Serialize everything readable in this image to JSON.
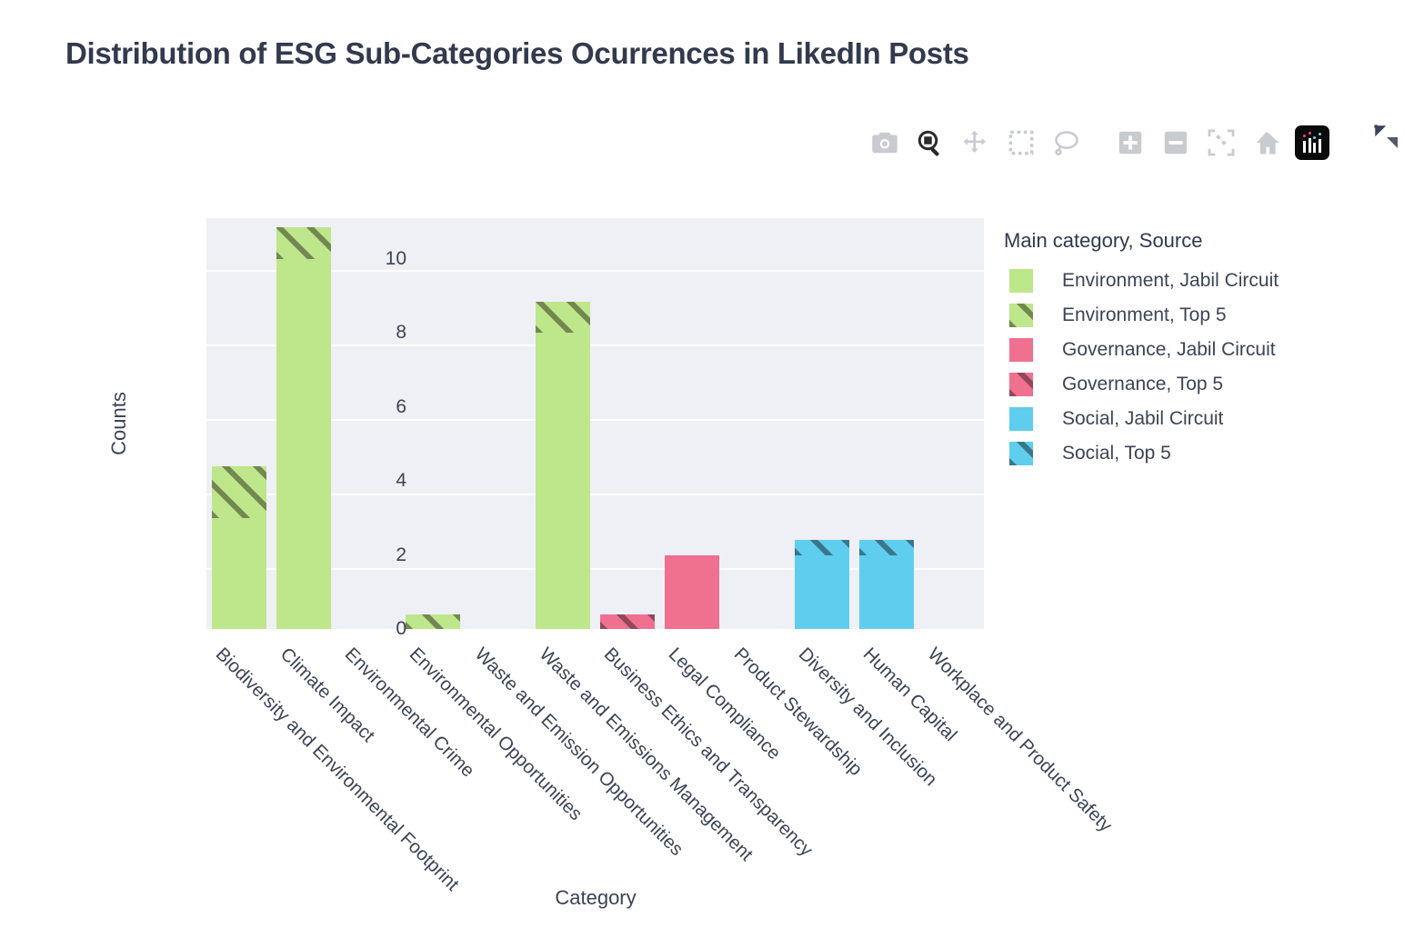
{
  "title": "Distribution of ESG Sub-Categories Ocurrences in LikedIn Posts",
  "modebar": {
    "buttons": [
      {
        "name": "download-plot-icon",
        "label": "Download plot as a png",
        "active": false
      },
      {
        "name": "zoom-icon",
        "label": "Zoom",
        "active": true
      },
      {
        "name": "pan-icon",
        "label": "Pan",
        "active": false
      },
      {
        "name": "box-select-icon",
        "label": "Box Select",
        "active": false
      },
      {
        "name": "lasso-select-icon",
        "label": "Lasso Select",
        "active": false
      },
      {
        "name": "zoom-in-icon",
        "label": "Zoom in",
        "active": false
      },
      {
        "name": "zoom-out-icon",
        "label": "Zoom out",
        "active": false
      },
      {
        "name": "autoscale-icon",
        "label": "Autoscale",
        "active": false
      },
      {
        "name": "home-icon",
        "label": "Reset axes",
        "active": false
      },
      {
        "name": "plotly-logo-icon",
        "label": "Produced with Plotly",
        "active": true
      }
    ],
    "collapse_label": "Collapse"
  },
  "legend": {
    "title": "Main category, Source",
    "items": [
      {
        "label": "Environment, Jabil Circuit",
        "color": "#bee68b",
        "pattern": "solid"
      },
      {
        "label": "Environment, Top 5",
        "color": "#bee68b",
        "pattern": "hatch"
      },
      {
        "label": "Governance, Jabil Circuit",
        "color": "#ef708f",
        "pattern": "solid"
      },
      {
        "label": "Governance, Top 5",
        "color": "#ef708f",
        "pattern": "hatch"
      },
      {
        "label": "Social, Jabil Circuit",
        "color": "#5ecdee",
        "pattern": "solid"
      },
      {
        "label": "Social, Top 5",
        "color": "#5ecdee",
        "pattern": "hatch"
      }
    ]
  },
  "chart_data": {
    "type": "bar",
    "barmode": "stack",
    "title": "Distribution of ESG Sub-Categories Ocurrences in LikedIn Posts",
    "xlabel": "Category",
    "ylabel": "Counts",
    "ylim": [
      0,
      11.1
    ],
    "yticks": [
      0,
      2,
      4,
      6,
      8,
      10
    ],
    "ytick_labels": [
      "0",
      "2",
      "4",
      "6",
      "8",
      "10"
    ],
    "grid": true,
    "xtick_rotation": -45,
    "legend_position": "right",
    "plot_bgcolor": "#eef0f5",
    "paper_bgcolor": "#ffffff",
    "gridcolor": "#ffffff",
    "categories": [
      "Biodiversity and Environmental Footprint",
      "Climate Impact",
      "Environmental Crime",
      "Environmental Opportunities",
      "Waste and Emission Opportunities",
      "Waste and Emissions Management",
      "Business Ethics and Transparency",
      "Legal Compliance",
      "Product Stewardship",
      "Diversity and Inclusion",
      "Human Capital",
      "Workplace and Product Safety"
    ],
    "series": [
      {
        "name": "Environment, Jabil Circuit",
        "color": "#bee68b",
        "pattern": "solid",
        "values": [
          3,
          10,
          0,
          0,
          0,
          8,
          0,
          0,
          0,
          0,
          0,
          0
        ]
      },
      {
        "name": "Environment, Top 5",
        "color": "#bee68b",
        "pattern": "hatch",
        "values": [
          1.4,
          0.85,
          0,
          0.4,
          0,
          0.85,
          0,
          0,
          0,
          0,
          0,
          0
        ]
      },
      {
        "name": "Governance, Jabil Circuit",
        "color": "#ef708f",
        "pattern": "solid",
        "values": [
          0,
          0,
          0,
          0,
          0,
          0,
          0,
          2,
          0,
          0,
          0,
          0
        ]
      },
      {
        "name": "Governance, Top 5",
        "color": "#ef708f",
        "pattern": "hatch",
        "values": [
          0,
          0,
          0,
          0,
          0,
          0,
          0.4,
          0,
          0,
          0,
          0,
          0
        ]
      },
      {
        "name": "Social, Jabil Circuit",
        "color": "#5ecdee",
        "pattern": "solid",
        "values": [
          0,
          0,
          0,
          0,
          0,
          0,
          0,
          0,
          0,
          2,
          2,
          0
        ]
      },
      {
        "name": "Social, Top 5",
        "color": "#5ecdee",
        "pattern": "hatch",
        "values": [
          0,
          0,
          0,
          0,
          0,
          0,
          0,
          0,
          0,
          0.4,
          0.4,
          0
        ]
      }
    ]
  }
}
